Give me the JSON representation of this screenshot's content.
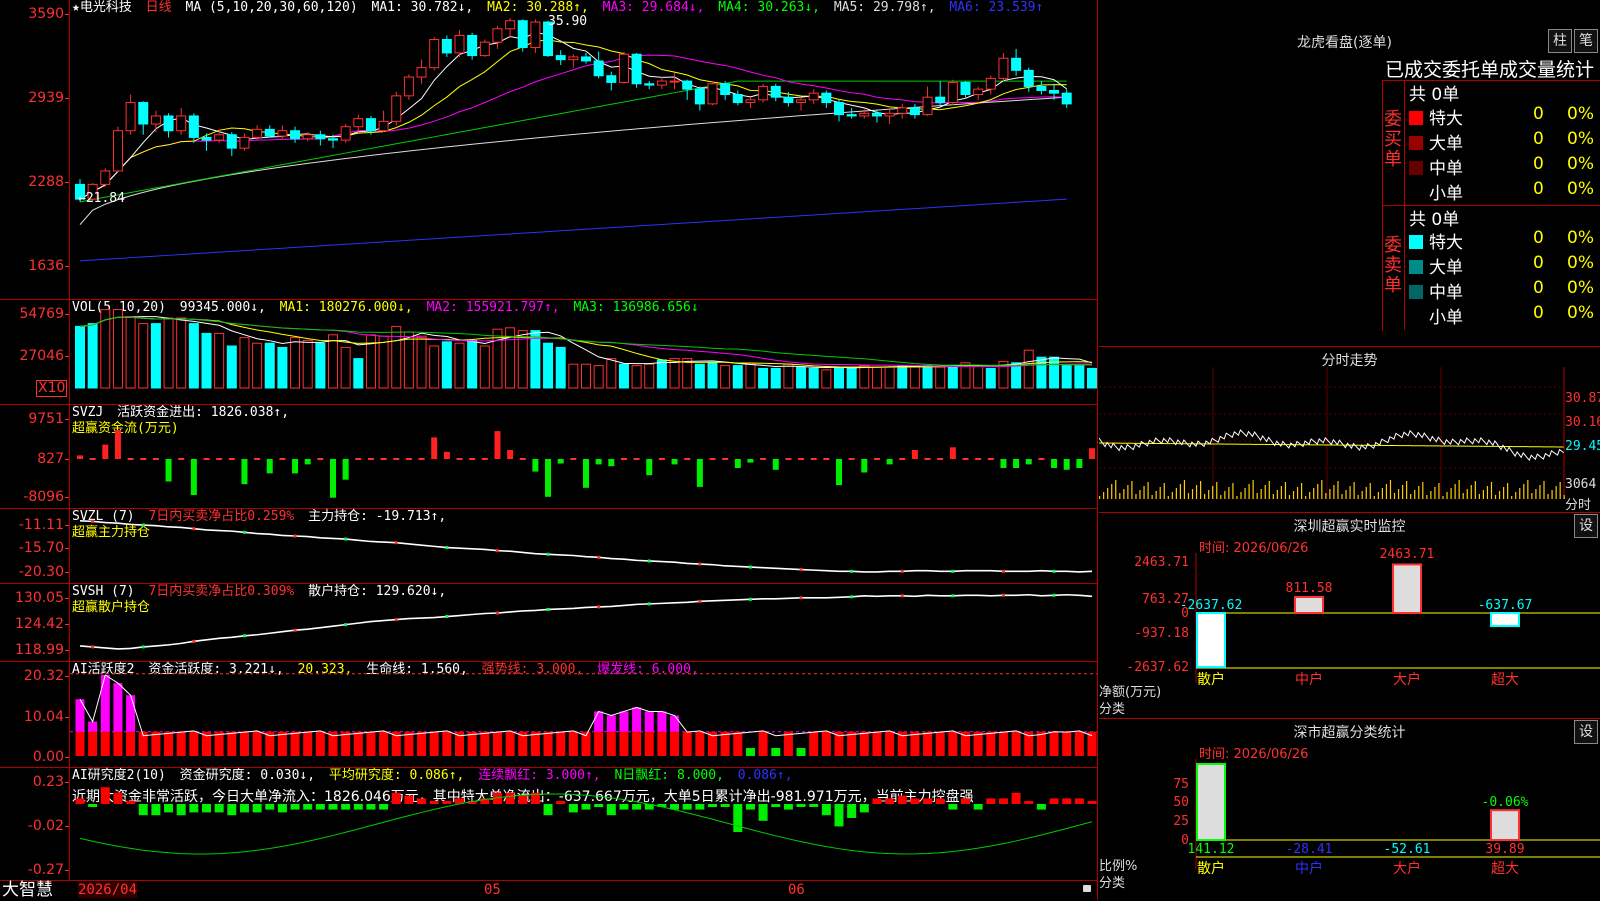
{
  "app": {
    "brand": "大智慧"
  },
  "kline": {
    "header": {
      "title": "★电光科技",
      "period": "日线",
      "ma_params": "MA (5,10,20,30,60,120)",
      "ma1": "MA1: 30.782↓,",
      "ma2": "MA2: 30.288↑,",
      "ma3": "MA3: 29.684↓,",
      "ma4": "MA4: 30.263↓,",
      "ma5": "MA5: 29.798↑,",
      "ma6": "MA6: 23.539↑"
    },
    "y_ticks": [
      "3590",
      "2939",
      "2288",
      "1636"
    ],
    "high_label": "35.90",
    "low_label": "←21.84",
    "candles": [
      [
        2.35,
        2.24,
        2.39,
        2.22
      ],
      [
        2.24,
        2.35,
        2.36,
        2.22
      ],
      [
        2.35,
        2.45,
        2.47,
        2.33
      ],
      [
        2.45,
        2.75,
        2.78,
        2.44
      ],
      [
        2.75,
        2.96,
        3.02,
        2.72
      ],
      [
        2.96,
        2.8,
        2.97,
        2.72
      ],
      [
        2.8,
        2.86,
        2.9,
        2.74
      ],
      [
        2.86,
        2.75,
        2.88,
        2.7
      ],
      [
        2.75,
        2.86,
        2.92,
        2.72
      ],
      [
        2.86,
        2.7,
        2.88,
        2.66
      ],
      [
        2.7,
        2.68,
        2.73,
        2.6
      ],
      [
        2.68,
        2.72,
        2.76,
        2.66
      ],
      [
        2.72,
        2.62,
        2.74,
        2.56
      ],
      [
        2.62,
        2.7,
        2.73,
        2.6
      ],
      [
        2.7,
        2.76,
        2.79,
        2.68
      ],
      [
        2.76,
        2.71,
        2.79,
        2.7
      ],
      [
        2.71,
        2.75,
        2.79,
        2.69
      ],
      [
        2.75,
        2.69,
        2.78,
        2.66
      ],
      [
        2.69,
        2.72,
        2.74,
        2.67
      ],
      [
        2.72,
        2.69,
        2.75,
        2.64
      ],
      [
        2.69,
        2.68,
        2.72,
        2.62
      ],
      [
        2.68,
        2.78,
        2.8,
        2.66
      ],
      [
        2.78,
        2.84,
        2.87,
        2.74
      ],
      [
        2.84,
        2.75,
        2.86,
        2.72
      ],
      [
        2.75,
        2.82,
        2.9,
        2.74
      ],
      [
        2.82,
        3.01,
        3.04,
        2.79
      ],
      [
        3.01,
        3.15,
        3.17,
        2.98
      ],
      [
        3.15,
        3.22,
        3.28,
        3.1
      ],
      [
        3.22,
        3.43,
        3.45,
        3.2
      ],
      [
        3.43,
        3.33,
        3.46,
        3.3
      ],
      [
        3.33,
        3.46,
        3.5,
        3.3
      ],
      [
        3.46,
        3.31,
        3.48,
        3.28
      ],
      [
        3.31,
        3.41,
        3.43,
        3.3
      ],
      [
        3.41,
        3.51,
        3.53,
        3.36
      ],
      [
        3.51,
        3.57,
        3.59,
        3.44
      ],
      [
        3.57,
        3.37,
        3.58,
        3.34
      ],
      [
        3.37,
        3.56,
        3.58,
        3.33
      ],
      [
        3.56,
        3.31,
        3.57,
        3.3
      ],
      [
        3.31,
        3.28,
        3.35,
        3.24
      ],
      [
        3.28,
        3.3,
        3.32,
        3.22
      ],
      [
        3.3,
        3.27,
        3.33,
        3.25
      ],
      [
        3.27,
        3.16,
        3.34,
        3.14
      ],
      [
        3.16,
        3.11,
        3.19,
        3.05
      ],
      [
        3.11,
        3.32,
        3.34,
        3.1
      ],
      [
        3.32,
        3.1,
        3.33,
        3.07
      ],
      [
        3.1,
        3.09,
        3.12,
        3.06
      ],
      [
        3.09,
        3.12,
        3.15,
        3.06
      ],
      [
        3.12,
        3.12,
        3.18,
        3.06
      ],
      [
        3.12,
        3.06,
        3.13,
        2.98
      ],
      [
        3.06,
        2.95,
        3.08,
        2.9
      ],
      [
        2.95,
        3.1,
        3.12,
        2.94
      ],
      [
        3.1,
        3.02,
        3.12,
        2.98
      ],
      [
        3.02,
        2.96,
        3.05,
        2.94
      ],
      [
        2.96,
        2.98,
        3.0,
        2.92
      ],
      [
        2.98,
        3.08,
        3.1,
        2.96
      ],
      [
        3.08,
        3.0,
        3.1,
        2.97
      ],
      [
        3.0,
        2.96,
        3.04,
        2.93
      ],
      [
        2.96,
        2.98,
        3.0,
        2.9
      ],
      [
        2.98,
        3.03,
        3.06,
        2.95
      ],
      [
        3.03,
        2.96,
        3.05,
        2.92
      ],
      [
        2.96,
        2.87,
        2.98,
        2.82
      ],
      [
        2.87,
        2.86,
        2.92,
        2.84
      ],
      [
        2.86,
        2.88,
        2.92,
        2.84
      ],
      [
        2.88,
        2.86,
        2.9,
        2.81
      ],
      [
        2.86,
        2.88,
        2.92,
        2.8
      ],
      [
        2.88,
        2.92,
        2.95,
        2.84
      ],
      [
        2.92,
        2.87,
        2.95,
        2.84
      ],
      [
        2.87,
        3.0,
        3.08,
        2.86
      ],
      [
        3.0,
        2.96,
        3.12,
        2.94
      ],
      [
        2.96,
        3.11,
        3.13,
        2.94
      ],
      [
        3.11,
        3.02,
        3.12,
        3.0
      ],
      [
        3.02,
        3.06,
        3.08,
        2.98
      ],
      [
        3.06,
        3.14,
        3.16,
        3.02
      ],
      [
        3.14,
        3.29,
        3.33,
        3.12
      ],
      [
        3.29,
        3.2,
        3.36,
        3.16
      ],
      [
        3.2,
        3.08,
        3.22,
        3.04
      ],
      [
        3.08,
        3.05,
        3.12,
        3.02
      ],
      [
        3.05,
        3.03,
        3.1,
        2.98
      ],
      [
        3.03,
        2.95,
        3.06,
        2.92
      ]
    ]
  },
  "volume": {
    "header": {
      "name": "VOL(5,10,20)",
      "value": "99345.000↓,",
      "ma1": "MA1: 180276.000↓,",
      "ma2": "MA2: 155921.797↑,",
      "ma3": "MA3: 136986.656↓"
    },
    "y_ticks": [
      "54769",
      "27046"
    ],
    "multiplier": "X10",
    "bars": [
      4.4,
      4.6,
      5.6,
      5.6,
      5.1,
      4.6,
      4.6,
      5.0,
      5.0,
      4.6,
      3.9,
      3.9,
      3.0,
      3.6,
      3.2,
      3.2,
      2.9,
      3.6,
      3.4,
      3.2,
      3.8,
      2.9,
      2.1,
      3.8,
      3.7,
      4.4,
      4.0,
      3.7,
      3.0,
      3.3,
      3.2,
      3.4,
      3.0,
      4.2,
      4.3,
      4.1,
      4.1,
      3.2,
      2.9,
      1.7,
      1.7,
      1.6,
      2.1,
      1.7,
      1.6,
      1.7,
      2.0,
      2.1,
      2.1,
      1.7,
      1.8,
      1.6,
      1.6,
      1.7,
      1.4,
      1.4,
      1.7,
      1.5,
      1.4,
      1.3,
      1.5,
      1.5,
      1.6,
      1.5,
      1.5,
      1.6,
      1.6,
      1.6,
      1.5,
      1.5,
      1.8,
      1.6,
      1.4,
      1.9,
      1.8,
      2.7,
      2.2,
      2.2,
      1.6,
      1.6,
      1.4
    ],
    "bar_cyan": [
      1,
      1,
      0,
      0,
      0,
      0,
      1,
      0,
      0,
      1,
      1,
      0,
      1,
      0,
      0,
      1,
      1,
      0,
      0,
      1,
      0,
      0,
      1,
      0,
      0,
      0,
      0,
      0,
      0,
      1,
      0,
      1,
      0,
      0,
      0,
      0,
      1,
      1,
      1,
      0,
      0,
      0,
      0,
      1,
      0,
      0,
      1,
      0,
      0,
      1,
      1,
      0,
      1,
      0,
      1,
      1,
      0,
      1,
      1,
      0,
      1,
      1,
      0,
      0,
      0,
      1,
      0,
      1,
      0,
      1,
      0,
      0,
      1,
      0,
      1,
      0,
      1,
      1,
      1,
      1,
      1
    ]
  },
  "svzj": {
    "header": {
      "name": "SVZJ",
      "label": "活跃资金进出: 1826.038↑,",
      "sub": "超赢资金流(万元)"
    },
    "y_ticks": [
      "9751",
      "827",
      "-8096"
    ],
    "bars": [
      0.4,
      0,
      1.6,
      3.2,
      0,
      0,
      0,
      -2.5,
      0,
      -4.0,
      0,
      0,
      0,
      -2.8,
      0,
      -1.6,
      0,
      -1.6,
      -0.6,
      0,
      -4.3,
      -2.3,
      0,
      0,
      0,
      0,
      0,
      0,
      2.4,
      0.8,
      0,
      0,
      0,
      3.1,
      1.0,
      0,
      -1.4,
      -4.2,
      -0.5,
      0,
      -3.2,
      -0.6,
      -0.8,
      0,
      0,
      -1.8,
      0,
      -0.6,
      0,
      -3.1,
      0,
      0,
      -1.0,
      -0.4,
      0,
      -1.2,
      0,
      0,
      0,
      0,
      -2.9,
      0,
      -1.5,
      0,
      -0.6,
      0,
      1.0,
      0,
      0,
      1.3,
      0,
      0,
      0,
      -1.0,
      -1.0,
      -0.6,
      0,
      -1.0,
      -1.2,
      -1.0,
      1.2
    ],
    "line": [
      0.2,
      0.2,
      0.3,
      0.4,
      0.3,
      0.2,
      0.2,
      0.1,
      0.1,
      0,
      0,
      0,
      0,
      0,
      0,
      0,
      0,
      0,
      0,
      0,
      0,
      0,
      0,
      0,
      0,
      0,
      0,
      0,
      0,
      0,
      0,
      0,
      0,
      0,
      0,
      0,
      0,
      0,
      0,
      0,
      0,
      0,
      0,
      0,
      0,
      0,
      0,
      0,
      0,
      0,
      0,
      0,
      0,
      0,
      0,
      0,
      0,
      0,
      0,
      0,
      0,
      0,
      0,
      0,
      0,
      0,
      0,
      0,
      0,
      0,
      0,
      0,
      0,
      0,
      0,
      0,
      0,
      0,
      0,
      0,
      0
    ]
  },
  "svzl": {
    "header": {
      "name": "SVZL (7)",
      "stat": "7日内买卖净占比0.259%",
      "label": "主力持仓: -19.713↑,",
      "sub": "超赢主力持仓"
    },
    "y_ticks": [
      "-11.11",
      "-15.70",
      "-20.30"
    ],
    "line": [
      -11.4,
      -11.5,
      -11.7,
      -11.8,
      -12.0,
      -12.1,
      -12.2,
      -12.4,
      -12.5,
      -12.7,
      -12.9,
      -13.0,
      -13.1,
      -13.3,
      -13.5,
      -13.6,
      -13.8,
      -13.9,
      -14.0,
      -14.2,
      -14.3,
      -14.4,
      -14.6,
      -14.8,
      -14.9,
      -15.0,
      -15.2,
      -15.4,
      -15.6,
      -15.8,
      -15.9,
      -16.0,
      -16.1,
      -16.3,
      -16.4,
      -16.6,
      -16.8,
      -16.9,
      -17.0,
      -17.1,
      -17.3,
      -17.4,
      -17.6,
      -17.7,
      -17.9,
      -18.0,
      -18.1,
      -18.2,
      -18.4,
      -18.5,
      -18.6,
      -18.8,
      -18.9,
      -19.0,
      -19.1,
      -19.2,
      -19.3,
      -19.4,
      -19.5,
      -19.6,
      -19.7,
      -19.7,
      -19.8,
      -19.8,
      -19.7,
      -19.7,
      -19.6,
      -19.6,
      -19.7,
      -19.7,
      -19.6,
      -19.6,
      -19.6,
      -19.7,
      -19.7,
      -19.7,
      -19.6,
      -19.7,
      -19.7,
      -19.8,
      -19.7
    ]
  },
  "svsh": {
    "header": {
      "name": "SVSH (7)",
      "stat": "7日内买卖净占比0.309%",
      "label": "散户持仓: 129.620↓,",
      "sub": "超赢散户持仓"
    },
    "y_ticks": [
      "130.05",
      "124.42",
      "118.99"
    ],
    "line": [
      119.8,
      119.6,
      119.4,
      119.2,
      119.3,
      119.6,
      119.8,
      120.0,
      120.3,
      120.7,
      121.0,
      121.3,
      121.5,
      121.8,
      122.0,
      122.3,
      122.6,
      122.9,
      123.1,
      123.4,
      123.7,
      124.0,
      124.3,
      124.6,
      124.8,
      125.0,
      125.2,
      125.3,
      125.4,
      125.6,
      125.8,
      126.0,
      126.2,
      126.3,
      126.5,
      126.7,
      126.8,
      127.0,
      127.1,
      127.2,
      127.4,
      127.5,
      127.6,
      127.8,
      128.0,
      128.1,
      128.2,
      128.3,
      128.4,
      128.6,
      128.7,
      128.8,
      128.9,
      129.0,
      129.1,
      129.1,
      129.2,
      129.3,
      129.3,
      129.3,
      129.4,
      129.5,
      129.7,
      129.6,
      129.7,
      129.7,
      129.6,
      129.8,
      129.7,
      129.7,
      129.8,
      129.8,
      129.7,
      129.8,
      129.8,
      129.9,
      129.7,
      129.8,
      129.9,
      129.8,
      129.6
    ]
  },
  "ai_act": {
    "header": {
      "name": "AI活跃度2",
      "label": "资金活跃度: 3.221↓,",
      "v2": "20.323,",
      "life": "生命线: 1.560,",
      "strong": "强势线: 3.000,",
      "burst": "爆发线: 6.000,"
    },
    "y_ticks": [
      "20.32",
      "10.04",
      "0.00"
    ],
    "bars": [
      14,
      8.5,
      20,
      18,
      15,
      6,
      6,
      6,
      6,
      6,
      6,
      6,
      6,
      6,
      6,
      6,
      6,
      6,
      6,
      6,
      6,
      6,
      6,
      6,
      6,
      6,
      6,
      6,
      6,
      6,
      6,
      6,
      6,
      6,
      6,
      6,
      6,
      6,
      6,
      6,
      6,
      11,
      10,
      11,
      12,
      11,
      11,
      10,
      6,
      6,
      6,
      6,
      6,
      6,
      6,
      6,
      6,
      6,
      6,
      6,
      6,
      6,
      6,
      6,
      6,
      6,
      6,
      6,
      6,
      6,
      6,
      6,
      6,
      6,
      6,
      6,
      6,
      6,
      6,
      6,
      6
    ],
    "pink": [
      1,
      1,
      1,
      1,
      1,
      0,
      0,
      0,
      0,
      0,
      0,
      0,
      0,
      0,
      0,
      0,
      0,
      0,
      0,
      0,
      0,
      0,
      0,
      0,
      0,
      0,
      0,
      0,
      0,
      0,
      0,
      0,
      0,
      0,
      0,
      0,
      0,
      0,
      0,
      0,
      0,
      1,
      1,
      1,
      1,
      1,
      1,
      1,
      0,
      0,
      0,
      0,
      0,
      0,
      0,
      0,
      0,
      0,
      0,
      0,
      0,
      0,
      0,
      0,
      0,
      0,
      0,
      0,
      0,
      0,
      0,
      0,
      0,
      0,
      0,
      0,
      0,
      1,
      0,
      0,
      0
    ]
  },
  "ai_res": {
    "header": {
      "name": "AI研究度2(10)",
      "label": "资金研究度: 0.030↓,",
      "avg": "平均研究度: 0.086↑,",
      "streak": "连续飘红: 3.000↑,",
      "nred": "N日飘红: 8.000,",
      "v": "0.086↑,"
    },
    "comment": "近期大资金非常活跃，今日大单净流入：1826.046万元，其中特大单净流出：-637.667万元，大单5日累计净出-981.971万元，当前主力控盘强",
    "y_ticks": [
      "0.23",
      "-0.02",
      "-0.27"
    ],
    "bars": [
      0.02,
      -0.01,
      0.06,
      0.04,
      0.01,
      -0.04,
      -0.04,
      -0.03,
      -0.04,
      -0.03,
      -0.03,
      -0.03,
      -0.04,
      -0.03,
      -0.03,
      -0.02,
      -0.03,
      -0.02,
      -0.02,
      -0.02,
      -0.02,
      -0.02,
      -0.02,
      -0.02,
      -0.02,
      0.04,
      0.03,
      0.02,
      0.01,
      0.01,
      0.02,
      0.01,
      0.02,
      0.04,
      0.04,
      0.03,
      0.04,
      -0.04,
      0.0,
      -0.03,
      -0.02,
      -0.01,
      -0.04,
      -0.02,
      -0.02,
      -0.02,
      -0.01,
      -0.02,
      -0.02,
      -0.02,
      -0.01,
      -0.01,
      -0.1,
      -0.02,
      -0.06,
      -0.01,
      -0.02,
      -0.01,
      -0.01,
      -0.04,
      -0.08,
      -0.05,
      -0.03,
      0.02,
      0.02,
      0.03,
      0.02,
      0.02,
      0.02,
      -0.02,
      0.02,
      -0.02,
      0.02,
      0.02,
      0.04,
      0.01,
      -0.02,
      0.02,
      0.02,
      0.02,
      0.01
    ]
  },
  "dates": {
    "start": "2026/04",
    "may": "05",
    "jun": "06"
  },
  "lhb": {
    "title": "龙虎看盘(逐单)",
    "btn1": "柱",
    "btn2": "笔",
    "subtitle": "已成交委托单成交量统计",
    "buy_label": "委买单",
    "sell_label": "委卖单",
    "buy_total": "共 0单",
    "sell_total": "共 0单",
    "buy": [
      {
        "name": "特大",
        "v": "0",
        "p": "0%",
        "color": "#ff0000"
      },
      {
        "name": "大单",
        "v": "0",
        "p": "0%",
        "color": "#990000"
      },
      {
        "name": "中单",
        "v": "0",
        "p": "0%",
        "color": "#660000"
      },
      {
        "name": "小单",
        "v": "0",
        "p": "0%",
        "color": "#000000"
      }
    ],
    "sell": [
      {
        "name": "特大",
        "v": "0",
        "p": "0%",
        "color": "#00ffff"
      },
      {
        "name": "大单",
        "v": "0",
        "p": "0%",
        "color": "#008b8b"
      },
      {
        "name": "中单",
        "v": "0",
        "p": "0%",
        "color": "#006666"
      },
      {
        "name": "小单",
        "v": "0",
        "p": "0%",
        "color": "#000000"
      }
    ]
  },
  "fenshi": {
    "title": "分时走势",
    "ticks": [
      "30.87",
      "30.16",
      "29.45",
      "3064"
    ],
    "label": "分时"
  },
  "shenzhen": {
    "title": "深圳超赢实时监控",
    "btn": "设",
    "time": "时间: 2026/06/26",
    "y_ticks": [
      "2463.71",
      "763.27",
      "0",
      "-937.18",
      "-2637.62"
    ],
    "cats": [
      "散户",
      "中户",
      "大户",
      "超大"
    ],
    "values": [
      -2637.62,
      811.58,
      2463.71,
      -637.67
    ],
    "value_labels": [
      "-2637.62",
      "811.58",
      "2463.71",
      "-637.67"
    ],
    "axis_label": "净额(万元)",
    "cat_label": "分类"
  },
  "shenshi": {
    "title": "深市超赢分类统计",
    "btn": "设",
    "time": "时间: 2026/06/26",
    "y_ticks": [
      "75",
      "50",
      "25",
      "0"
    ],
    "cats": [
      "散户",
      "中户",
      "大户",
      "超大"
    ],
    "values": [
      141.12,
      -28.41,
      -52.61,
      39.89
    ],
    "value_labels": [
      "141.12",
      "-28.41",
      "-52.61",
      "39.89"
    ],
    "top_label": "-0.06%",
    "axis_label": "比例%",
    "cat_label": "分类"
  }
}
